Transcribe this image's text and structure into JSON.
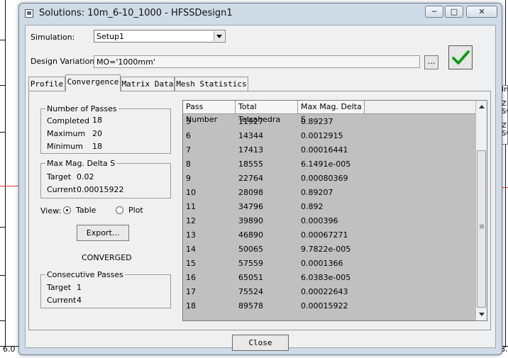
{
  "window": {
    "title": "Solutions: 10m_6-10_1000 - HFSSDesign1"
  },
  "simulation": {
    "label": "Simulation:",
    "selected": "Setup1"
  },
  "design_variation": {
    "label": "Design Variation:",
    "value": "MO='1000mm'",
    "browse_label": "..."
  },
  "tabs": [
    {
      "label": "Profile"
    },
    {
      "label": "Convergence"
    },
    {
      "label": "Matrix Data"
    },
    {
      "label": "Mesh Statistics"
    }
  ],
  "passes": {
    "title": "Number of Passes",
    "completed_label": "Completed",
    "completed": "18",
    "maximum_label": "Maximum",
    "maximum": "20",
    "minimum_label": "Minimum",
    "minimum": "18"
  },
  "delta_s": {
    "title": "Max Mag. Delta S",
    "target_label": "Target",
    "target": "0.02",
    "current_label": "Current",
    "current": "0.00015922"
  },
  "view": {
    "label": "View:",
    "table_label": "Table",
    "plot_label": "Plot",
    "selected": "Table"
  },
  "export_label": "Export...",
  "status": "CONVERGED",
  "consecutive": {
    "title": "Consecutive Passes",
    "target_label": "Target",
    "target": "1",
    "current_label": "Current",
    "current": "4"
  },
  "table": {
    "headers": [
      "Pass Number",
      "Total Tetrahedra",
      "Max Mag. Delta S"
    ],
    "rows": [
      [
        "5",
        "11927",
        "0.89237"
      ],
      [
        "6",
        "14344",
        "0.0012915"
      ],
      [
        "7",
        "17413",
        "0.00016441"
      ],
      [
        "8",
        "18555",
        "6.1491e-005"
      ],
      [
        "9",
        "22764",
        "0.00080369"
      ],
      [
        "10",
        "28098",
        "0.89207"
      ],
      [
        "11",
        "34796",
        "0.892"
      ],
      [
        "12",
        "39890",
        "0.000396"
      ],
      [
        "13",
        "46890",
        "0.00067271"
      ],
      [
        "14",
        "50065",
        "9.7822e-005"
      ],
      [
        "15",
        "57559",
        "0.0001366"
      ],
      [
        "16",
        "65051",
        "6.0383e-005"
      ],
      [
        "17",
        "75524",
        "0.00022643"
      ],
      [
        "18",
        "89578",
        "0.00015922"
      ]
    ]
  },
  "close_label": "Close",
  "background": {
    "left_axis_label": "6.0",
    "right_axis_label": "8.",
    "right_snippets": [
      "In",
      "Z(",
      "Sw",
      "Z(",
      "Sw"
    ]
  },
  "colors": {
    "check": "#1fae2b",
    "window_frame": "#cfdbe6",
    "table_bg": "#c0c0c0"
  }
}
